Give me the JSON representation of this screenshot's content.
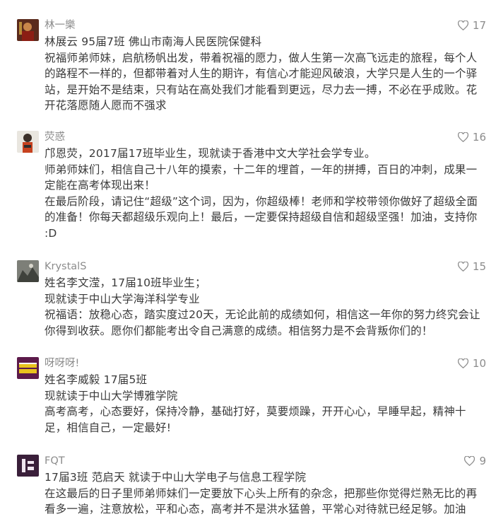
{
  "comments": [
    {
      "name": "林一樂",
      "likes": "17",
      "lines": [
        "林展云  95届7班  佛山市南海人民医院保健科",
        "祝福师弟师妹，启航杨帆出发，带着祝福的愿力，做人生第一次高飞远走的旅程，每个人的路程不一样的，但都带着对人生的期许，有信心才能迎风破浪，大学只是人生的一个驿站，是开始不是结束，只有站在高处我们才能看到更远，尽力去一搏，不必在乎成败。花开花落愿随人愿而不强求"
      ]
    },
    {
      "name": "荧惑",
      "likes": "16",
      "lines": [
        "邝恩荧，2017届17班毕业生，现就读于香港中文大学社会学专业。",
        "师弟师妹们，相信自己十八年的摸索，十二年的埋首，一年的拼搏，百日的冲刺，成果一定能在高考体现出来！",
        "在最后阶段，请记住“超级”这个词，因为，你超级棒！老师和学校带领你做好了超级全面的准备！你每天都超级乐观向上！最后，一定要保持超级自信和超级坚强！加油，支持你 :D"
      ]
    },
    {
      "name": "KrystalS",
      "likes": "15",
      "lines": [
        "姓名李文滢，17届10班毕业生；",
        "现就读于中山大学海洋科学专业",
        "祝福语：放稳心态，踏实度过20天，无论此前的成绩如何，相信这一年你的努力终究会让你得到收获。愿你们都能考出令自己满意的成绩。相信努力是不会背叛你们的！"
      ]
    },
    {
      "name": "呀呀呀!",
      "likes": "10",
      "lines": [
        "姓名李威毅  17届5班",
        "现就读于中山大学博雅学院",
        "高考高考，心态要好，保持冷静，基础打好，莫要烦躁，开开心心，早睡早起，精神十足，相信自己，一定最好!"
      ]
    },
    {
      "name": "FQT",
      "likes": "9",
      "lines": [
        "17届3班  范启天  就读于中山大学电子与信息工程学院",
        "在这最后的日子里师弟师妹们一定要放下心头上所有的杂念，把那些你觉得烂熟无比的再看多一遍，注意放松，平和心态，高考并不是洪水猛兽，平常心对待就已经足够。加油"
      ]
    }
  ]
}
